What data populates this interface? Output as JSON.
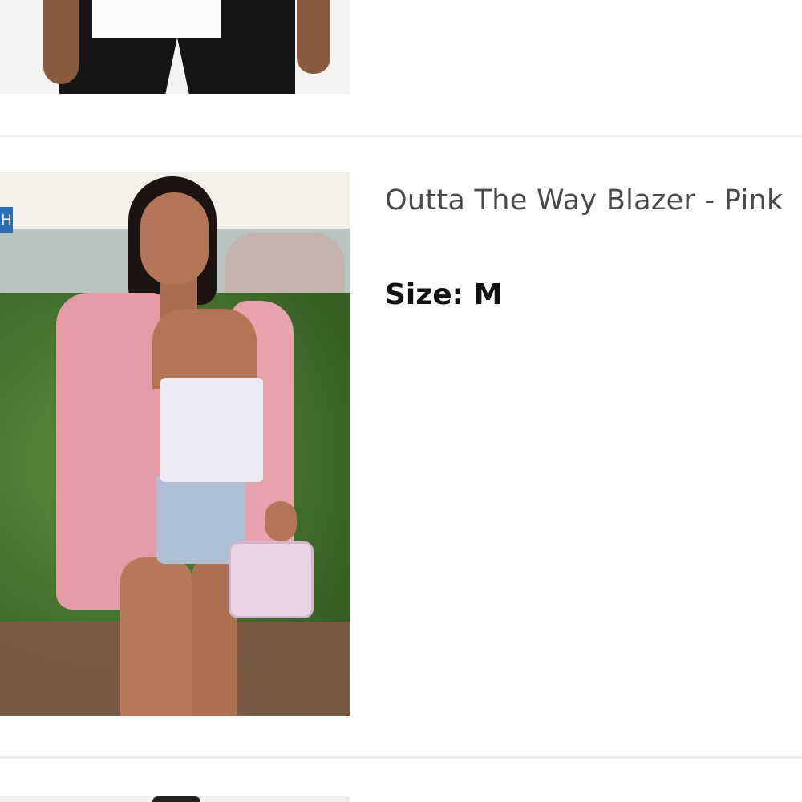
{
  "product": {
    "title": "Outta The Way Blazer - Pink",
    "size_label": "Size:",
    "size_value": "M"
  },
  "photo": {
    "sign_text": "H"
  }
}
